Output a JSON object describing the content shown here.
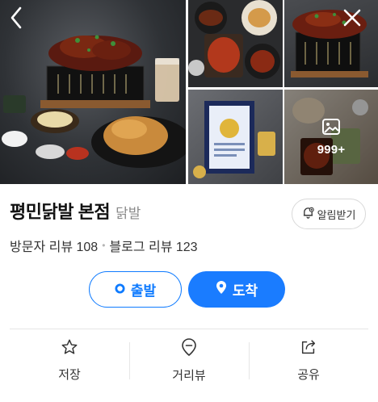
{
  "gallery": {
    "more_count": "999+"
  },
  "place": {
    "name": "평민닭발 본점",
    "category": "닭발"
  },
  "alarm_label": "알림받기",
  "reviews": {
    "visitor": "방문자 리뷰 108",
    "separator": "•",
    "blog": "블로그 리뷰 123"
  },
  "route": {
    "depart_label": "출발",
    "arrive_label": "도착"
  },
  "actions": {
    "save_label": "저장",
    "street_view_label": "거리뷰",
    "share_label": "공유"
  },
  "colors": {
    "accent": "#1a7cff",
    "text": "#222222",
    "muted": "#8a8a8a"
  }
}
